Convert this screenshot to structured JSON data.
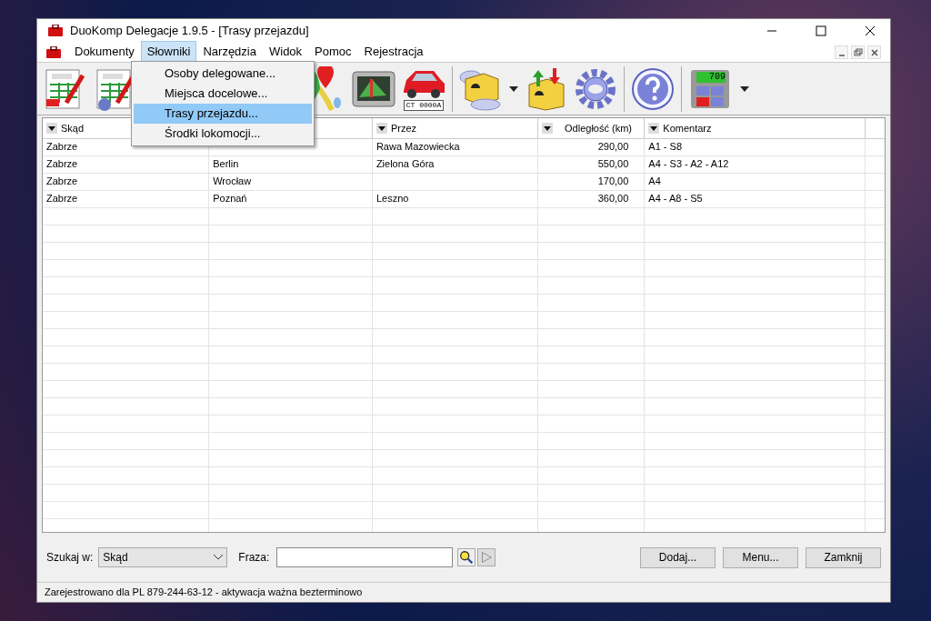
{
  "window": {
    "title": "DuoKomp Delegacje 1.9.5 - [Trasy przejazdu]"
  },
  "menu": [
    {
      "label": "Dokumenty",
      "selected": false
    },
    {
      "label": "Słowniki",
      "selected": true
    },
    {
      "label": "Narzędzia",
      "selected": false
    },
    {
      "label": "Widok",
      "selected": false
    },
    {
      "label": "Pomoc",
      "selected": false
    },
    {
      "label": "Rejestracja",
      "selected": false
    }
  ],
  "dropdown": [
    {
      "label": "Osoby delegowane...",
      "selected": false
    },
    {
      "label": "Miejsca docelowe...",
      "selected": false
    },
    {
      "label": "Trasy przejazdu...",
      "selected": true
    },
    {
      "label": "Środki lokomocji...",
      "selected": false
    }
  ],
  "toolbar": {
    "plate": "CT 0000A",
    "calc_display": "709"
  },
  "table": {
    "columns": [
      {
        "label": "Skąd",
        "kind": "text"
      },
      {
        "kind": "text"
      },
      {
        "label": "Przez",
        "kind": "text"
      },
      {
        "label": "Odległość (km)",
        "kind": "number"
      },
      {
        "label": "Komentarz",
        "kind": "text"
      }
    ],
    "rows": [
      [
        "Zabrze",
        null,
        "Rawa Mazowiecka",
        "290,00",
        "A1 - S8"
      ],
      [
        "Zabrze",
        "Berlin",
        "Zielona Góra",
        "550,00",
        "A4 - S3 - A2 - A12"
      ],
      [
        "Zabrze",
        "Wrocław",
        null,
        "170,00",
        "A4"
      ],
      [
        "Zabrze",
        "Poznań",
        "Leszno",
        "360,00",
        "A4 - A8 - S5"
      ]
    ]
  },
  "search": {
    "label": "Szukaj w:",
    "field": "Skąd",
    "phrase_label": "Fraza:"
  },
  "buttons": [
    "Dodaj...",
    "Menu...",
    "Zamknij"
  ],
  "status_bar": "Zarejestrowano dla PL 879-244-63-12 - aktywacja ważna bezterminowo"
}
